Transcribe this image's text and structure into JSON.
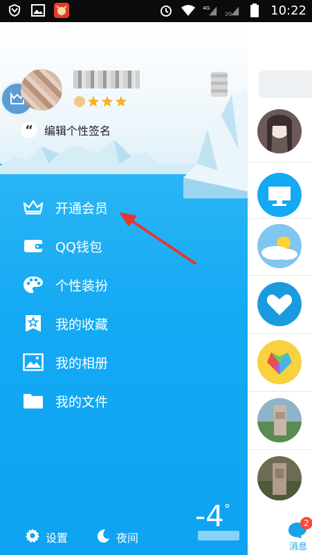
{
  "status_bar": {
    "time": "10:22",
    "icons": [
      "shield-icon",
      "image-icon",
      "app-notification-icon",
      "alarm-icon",
      "wifi-icon",
      "signal-4g-icon",
      "signal-2g-icon",
      "battery-icon"
    ]
  },
  "profile": {
    "signature_hint": "编辑个性签名",
    "level_icons": [
      "sun-level-icon",
      "star-level-icon",
      "star-level-icon",
      "star-level-icon"
    ]
  },
  "menu": {
    "items": [
      {
        "label": "开通会员",
        "icon": "crown-icon"
      },
      {
        "label": "QQ钱包",
        "icon": "wallet-icon"
      },
      {
        "label": "个性装扮",
        "icon": "palette-icon"
      },
      {
        "label": "我的收藏",
        "icon": "favorites-icon"
      },
      {
        "label": "我的相册",
        "icon": "album-icon"
      },
      {
        "label": "我的文件",
        "icon": "folder-icon"
      }
    ]
  },
  "bottom": {
    "settings_label": "设置",
    "night_label": "夜间",
    "temperature": "-4",
    "degree": "°"
  },
  "sidebar_right": {
    "items": [
      "contact-avatar",
      "computer-icon",
      "weather-icon",
      "heart-icon",
      "colorful-heart-icon",
      "contact-avatar",
      "contact-avatar"
    ],
    "messages_label": "消息",
    "messages_badge": "2"
  },
  "colors": {
    "sea_blue": "#13a9f3",
    "accent_blue": "#1aa4e8",
    "badge_red": "#ff4a3b",
    "arrow_red": "#e8362c"
  }
}
